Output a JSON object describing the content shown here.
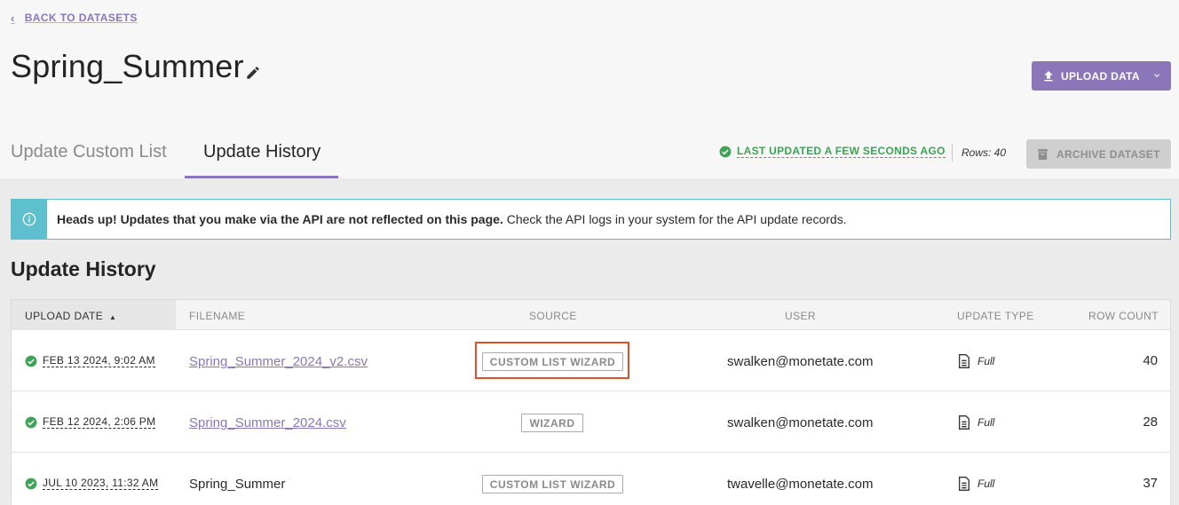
{
  "nav": {
    "back_label": "BACK TO DATASETS"
  },
  "dataset": {
    "title": "Spring_Summer"
  },
  "actions": {
    "upload_label": "UPLOAD DATA",
    "archive_label": "ARCHIVE DATASET"
  },
  "tabs": [
    {
      "label": "Update Custom List",
      "active": false
    },
    {
      "label": "Update History",
      "active": true
    }
  ],
  "status": {
    "last_updated": "LAST UPDATED A FEW SECONDS AGO",
    "rows": "Rows: 40"
  },
  "alert": {
    "bold": "Heads up! Updates that you make via the API are not reflected on this page.",
    "text": " Check the API logs in your system for the API update records."
  },
  "section": {
    "title": "Update History"
  },
  "table": {
    "headers": {
      "upload_date": "UPLOAD DATE",
      "filename": "FILENAME",
      "source": "SOURCE",
      "user": "USER",
      "update_type": "UPDATE TYPE",
      "row_count": "ROW COUNT"
    },
    "rows": [
      {
        "date": "FEB 13 2024, 9:02 AM",
        "filename": "Spring_Summer_2024_v2.csv",
        "filename_is_link": true,
        "source": "CUSTOM LIST WIZARD",
        "user": "swalken@monetate.com",
        "update_type": "Full",
        "row_count": "40"
      },
      {
        "date": "FEB 12 2024, 2:06 PM",
        "filename": "Spring_Summer_2024.csv",
        "filename_is_link": true,
        "source": "WIZARD",
        "user": "swalken@monetate.com",
        "update_type": "Full",
        "row_count": "28"
      },
      {
        "date": "JUL 10 2023, 11:32 AM",
        "filename": "Spring_Summer",
        "filename_is_link": false,
        "source": "CUSTOM LIST WIZARD",
        "user": "twavelle@monetate.com",
        "update_type": "Full",
        "row_count": "37"
      }
    ]
  },
  "colors": {
    "accent": "#8a76b8",
    "success": "#3fa355",
    "info": "#5dc0cc",
    "highlight": "#e0502a"
  },
  "icons": [
    "chevron-left-icon",
    "pencil-icon",
    "upload-icon",
    "chevron-down-icon",
    "check-circle-icon",
    "archive-icon",
    "info-icon",
    "sort-asc-icon",
    "document-icon"
  ]
}
